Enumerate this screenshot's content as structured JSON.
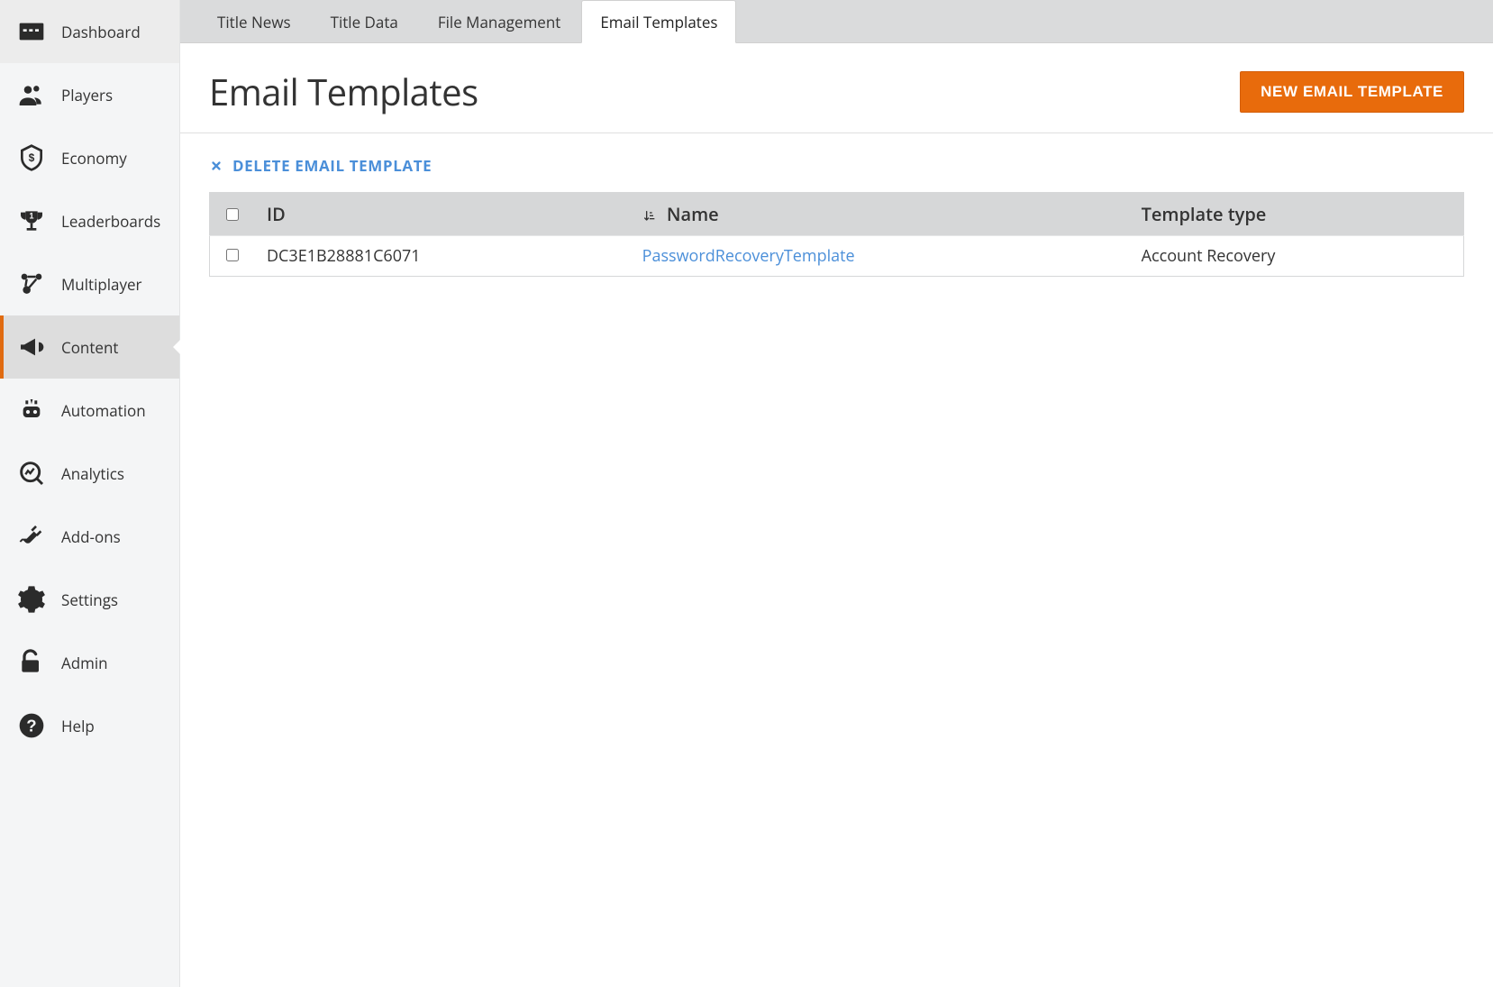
{
  "sidebar": {
    "items": [
      {
        "label": "Dashboard"
      },
      {
        "label": "Players"
      },
      {
        "label": "Economy"
      },
      {
        "label": "Leaderboards"
      },
      {
        "label": "Multiplayer"
      },
      {
        "label": "Content"
      },
      {
        "label": "Automation"
      },
      {
        "label": "Analytics"
      },
      {
        "label": "Add-ons"
      },
      {
        "label": "Settings"
      },
      {
        "label": "Admin"
      },
      {
        "label": "Help"
      }
    ],
    "active_index": 5
  },
  "tabs": {
    "items": [
      {
        "label": "Title News"
      },
      {
        "label": "Title Data"
      },
      {
        "label": "File Management"
      },
      {
        "label": "Email Templates"
      }
    ],
    "active_index": 3
  },
  "page": {
    "title": "Email Templates",
    "new_button": "NEW EMAIL TEMPLATE",
    "delete_action": "DELETE EMAIL TEMPLATE"
  },
  "table": {
    "columns": {
      "id": "ID",
      "name": "Name",
      "type": "Template type"
    },
    "rows": [
      {
        "id": "DC3E1B28881C6071",
        "name": "PasswordRecoveryTemplate",
        "type": "Account Recovery"
      }
    ]
  }
}
